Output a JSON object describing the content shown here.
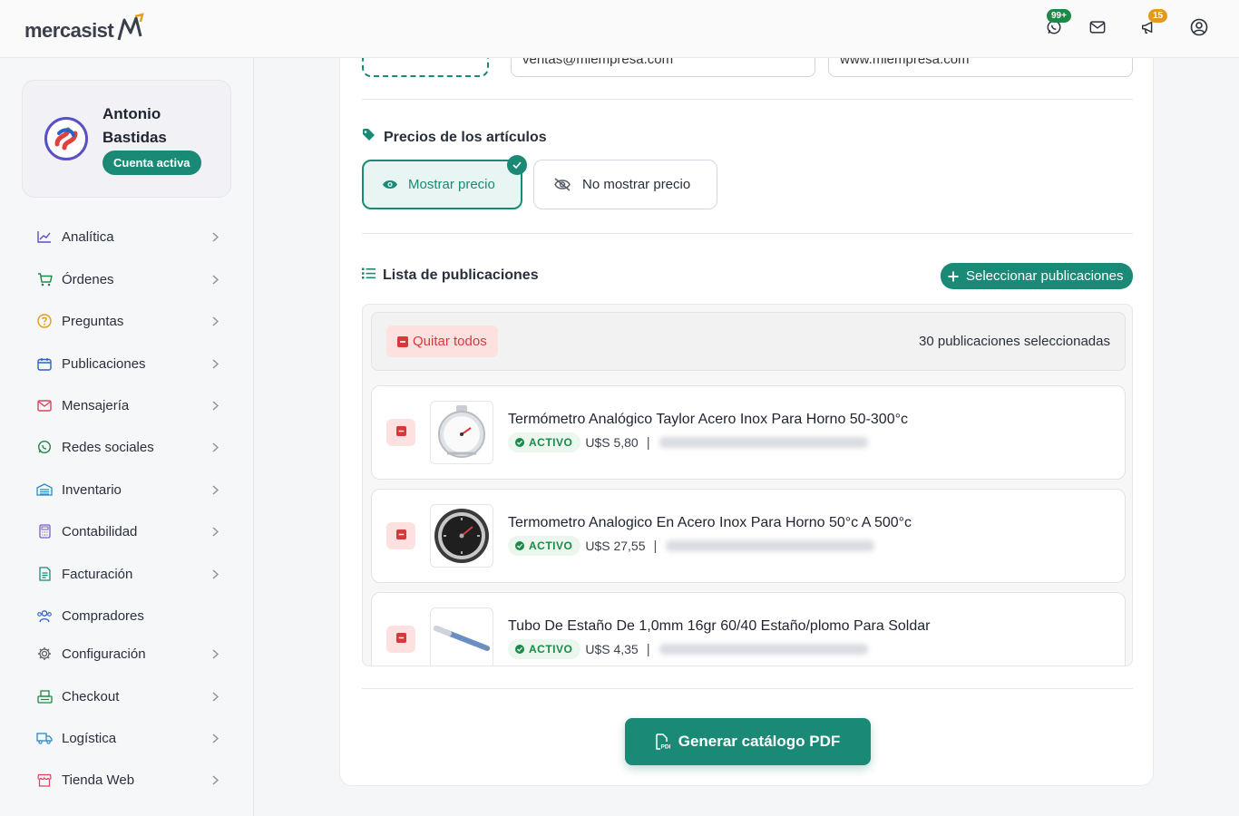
{
  "header": {
    "logo_text": "mercasist",
    "whatsapp_badge": "99+",
    "notifications_badge": "15",
    "accent": "#1a8a76"
  },
  "sidebar": {
    "profile": {
      "name": "Antonio Bastidas",
      "status": "Cuenta activa"
    },
    "items": [
      {
        "label": "Analítica",
        "icon": "chart-line-icon",
        "chevron": true
      },
      {
        "label": "Órdenes",
        "icon": "cart-icon",
        "chevron": true
      },
      {
        "label": "Preguntas",
        "icon": "question-circle-icon",
        "chevron": true
      },
      {
        "label": "Publicaciones",
        "icon": "calendar-icon",
        "chevron": true
      },
      {
        "label": "Mensajería",
        "icon": "envelope-icon",
        "chevron": true
      },
      {
        "label": "Redes sociales",
        "icon": "whatsapp-icon",
        "chevron": true
      },
      {
        "label": "Inventario",
        "icon": "warehouse-icon",
        "chevron": true
      },
      {
        "label": "Contabilidad",
        "icon": "calculator-icon",
        "chevron": true
      },
      {
        "label": "Facturación",
        "icon": "invoice-icon",
        "chevron": true
      },
      {
        "label": "Compradores",
        "icon": "users-icon",
        "chevron": false
      },
      {
        "label": "Configuración",
        "icon": "gear-icon",
        "chevron": true
      },
      {
        "label": "Checkout",
        "icon": "register-icon",
        "chevron": true
      },
      {
        "label": "Logística",
        "icon": "truck-icon",
        "chevron": true
      },
      {
        "label": "Tienda Web",
        "icon": "store-icon",
        "chevron": true
      }
    ]
  },
  "main": {
    "email_value": "ventas@miempresa.com",
    "website_value": "www.miempresa.com",
    "prices_section": {
      "title": "Precios de los artículos",
      "show_label": "Mostrar precio",
      "hide_label": "No mostrar precio",
      "selected": "show"
    },
    "list_section": {
      "title": "Lista de publicaciones",
      "select_button": "Seleccionar publicaciones",
      "remove_all": "Quitar todos",
      "count_text": "30 publicaciones seleccionadas",
      "items": [
        {
          "title": "Termómetro Analógico Taylor Acero Inox Para Horno 50-300°c",
          "status": "ACTIVO",
          "price": "U$S 5,80",
          "thumb": "oven-thermometer-dial"
        },
        {
          "title": "Termometro Analogico En Acero Inox Para Horno 50°c A 500°c",
          "status": "ACTIVO",
          "price": "U$S 27,55",
          "thumb": "round-dial-thermometer"
        },
        {
          "title": "Tubo De Estaño De 1,0mm 16gr 60/40 Estaño/plomo Para Soldar",
          "status": "ACTIVO",
          "price": "U$S 4,35",
          "thumb": "solder-tube"
        }
      ]
    },
    "generate_button": "Generar catálogo PDF"
  }
}
